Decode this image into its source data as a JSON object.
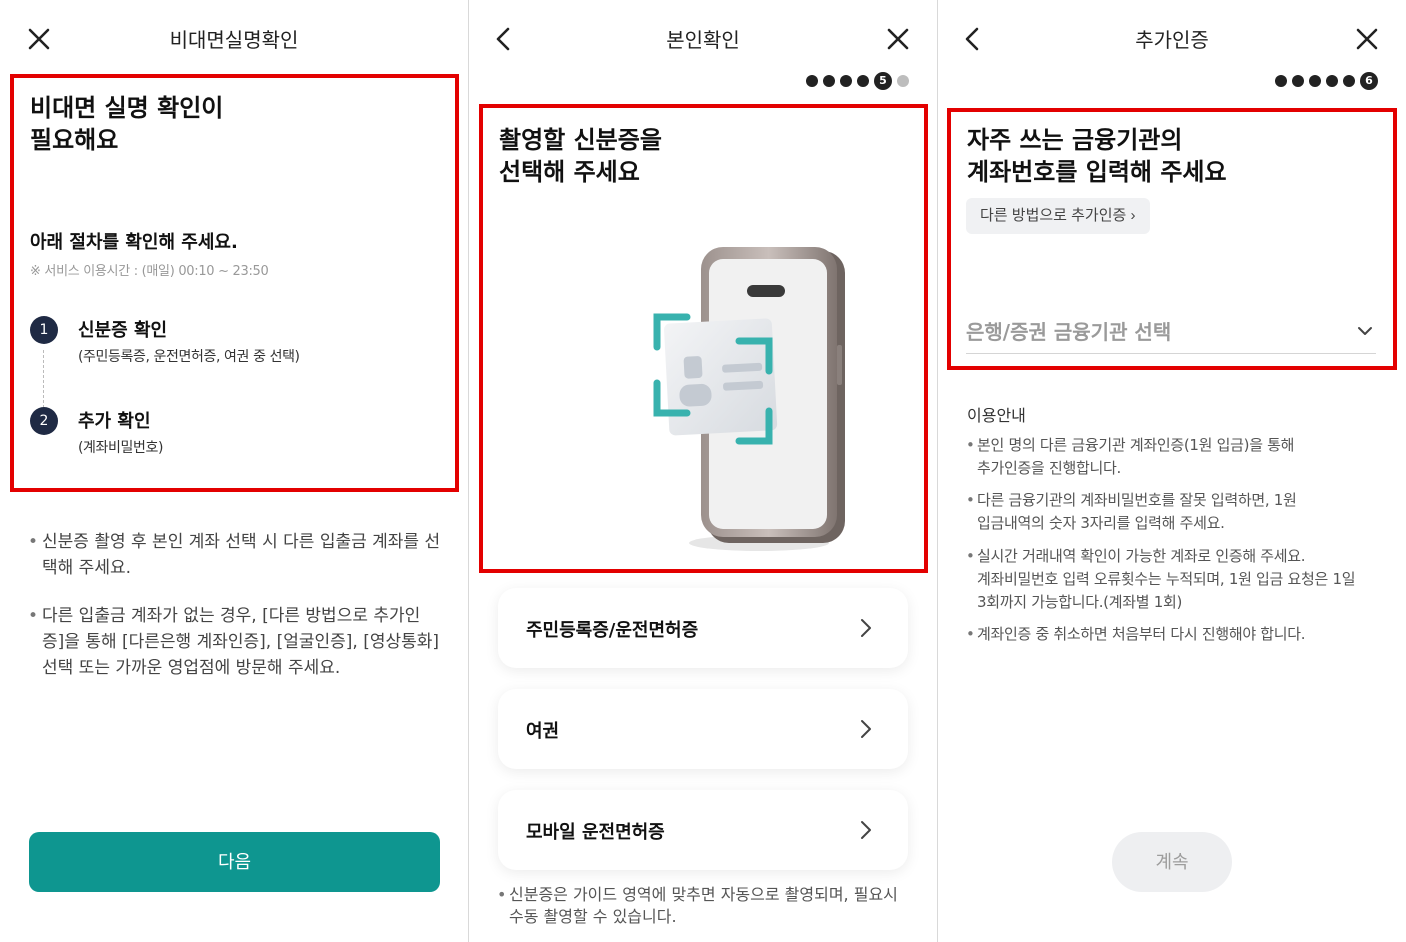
{
  "screen1": {
    "header": {
      "title": "비대면실명확인",
      "close_icon": "close-icon"
    },
    "headline": "비대면 실명 확인이\n필요해요",
    "subheading": "아래 절차를 확인해 주세요.",
    "service_time": "※ 서비스 이용시간 : (매일) 00:10 ~ 23:50",
    "steps": [
      {
        "number": "1",
        "label": "신분증 확인",
        "desc": "(주민등록증, 운전면허증, 여권 중 선택)"
      },
      {
        "number": "2",
        "label": "추가 확인",
        "desc": "(계좌비밀번호)"
      }
    ],
    "notes": [
      "신분증 촬영 후 본인 계좌 선택 시 다른 입출금 계좌를 선택해 주세요.",
      "다른 입출금 계좌가 없는 경우, [다른 방법으로 추가인증]을 통해 [다른은행 계좌인증], [얼굴인증], [영상통화] 선택 또는 가까운 영업점에 방문해 주세요."
    ],
    "next_button": "다음",
    "accent_color": "#0e9690"
  },
  "screen2": {
    "header": {
      "title": "본인확인",
      "back_icon": "chevron-left-icon",
      "close_icon": "close-icon"
    },
    "progress": {
      "current_step": "5",
      "total_steps": 6
    },
    "headline": "촬영할 신분증을\n선택해 주세요",
    "options": [
      {
        "label": "주민등록증/운전면허증"
      },
      {
        "label": "여권"
      },
      {
        "label": "모바일 운전면허증"
      }
    ],
    "note": "신분증은 가이드 영역에 맞추면 자동으로 촬영되며, 필요시 수동 촬영할 수 있습니다."
  },
  "screen3": {
    "header": {
      "title": "추가인증",
      "back_icon": "chevron-left-icon",
      "close_icon": "close-icon"
    },
    "progress": {
      "current_step": "6",
      "total_steps": 6
    },
    "headline": "자주 쓰는 금융기관의\n계좌번호를 입력해 주세요",
    "alt_method_button": "다른 방법으로 추가인증 ›",
    "institution_select_placeholder": "은행/증권 금융기관 선택",
    "info_title": "이용안내",
    "info_items": [
      "본인 명의 다른 금융기관 계좌인증(1원 입금)을 통해\n추가인증을 진행합니다.",
      "다른 금융기관의 계좌비밀번호를 잘못 입력하면, 1원\n입금내역의 숫자 3자리를 입력해 주세요.",
      "실시간 거래내역 확인이 가능한 계좌로 인증해 주세요.\n계좌비밀번호 입력 오류횟수는 누적되며, 1원 입금 요청은 1일\n3회까지 가능합니다.(계좌별 1회)",
      "계좌인증 중 취소하면 처음부터 다시 진행해야 합니다."
    ],
    "continue_button": "계속"
  },
  "highlight_color": "#e30000"
}
